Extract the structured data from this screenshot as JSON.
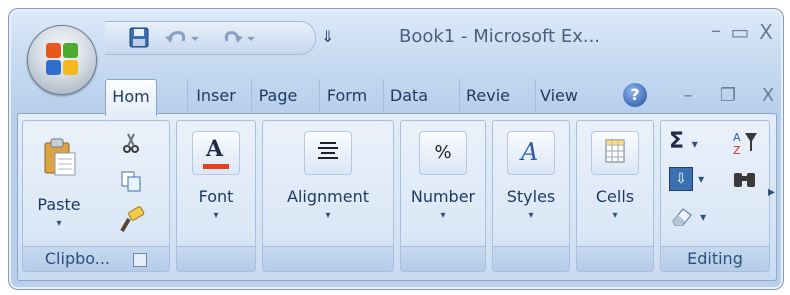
{
  "window": {
    "title": "Book1 - Microsoft Ex...",
    "minimize_glyph": "–",
    "maximize_glyph": "▭",
    "close_glyph": "X"
  },
  "quick_access": {
    "customize_glyph": "⇓",
    "icons": [
      "save-icon",
      "undo-icon",
      "redo-icon"
    ]
  },
  "tabs": [
    {
      "label": "Hom",
      "active": true
    },
    {
      "label": "Inser"
    },
    {
      "label": "Page"
    },
    {
      "label": "Form"
    },
    {
      "label": "Data"
    },
    {
      "label": "Revie"
    },
    {
      "label": "View"
    }
  ],
  "help_glyph": "?",
  "mdi": {
    "minimize_glyph": "–",
    "restore_glyph": "❐",
    "close_glyph": "X"
  },
  "ribbon": {
    "groups": [
      {
        "label": "Clipbo...",
        "button": "Paste"
      },
      {
        "label": "",
        "button": "Font",
        "icon_text": "A"
      },
      {
        "label": "",
        "button": "Alignment"
      },
      {
        "label": "",
        "button": "Number",
        "icon_text": "%"
      },
      {
        "label": "",
        "button": "Styles",
        "icon_text": "A"
      },
      {
        "label": "",
        "button": "Cells"
      },
      {
        "label": "Editing",
        "sum_glyph": "Σ",
        "sort_glyph": "A\nZ",
        "find_glyph": "M"
      }
    ],
    "scroll_glyph": "▸",
    "dropdown_glyph": "▾"
  },
  "colors": {
    "accent": "#1f3a64",
    "font_color_bar": "#e8401c"
  }
}
